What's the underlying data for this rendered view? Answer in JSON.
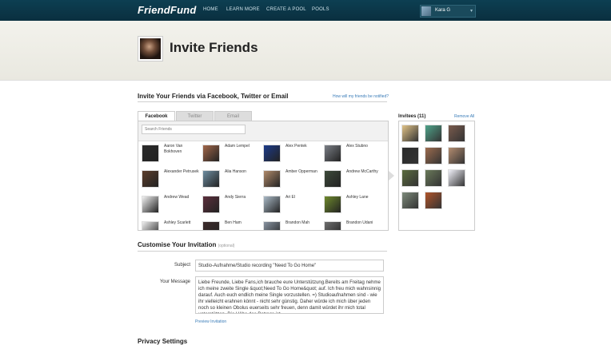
{
  "brand": "FriendFund",
  "nav": [
    "HOME",
    "LEARN MORE",
    "CREATE A POOL",
    "POOLS"
  ],
  "user": {
    "name": "Kara G",
    "avatar_icon": "user-avatar"
  },
  "page_title": "Invite Friends",
  "invite_section": {
    "title": "Invite Your Friends via Facebook, Twitter or Email",
    "help_link": "How will my friends be notified?",
    "tabs": [
      "Facebook",
      "Twitter",
      "Email"
    ],
    "active_tab": "Facebook",
    "search_placeholder": "Search Friends"
  },
  "friends": [
    {
      "name": "Aaron Van Bokhoven",
      "color": "#2a2a2a"
    },
    {
      "name": "Adam Lempel",
      "color": "#a2674a"
    },
    {
      "name": "Alex Pentek",
      "color": "#1d3b8a"
    },
    {
      "name": "Alex Stubno",
      "color": "#7b7f86"
    },
    {
      "name": "Alexander Petrusek",
      "color": "#5b3d2c"
    },
    {
      "name": "Alia Hanson",
      "color": "#6e8da0"
    },
    {
      "name": "Amber Opperman",
      "color": "#b08a6a"
    },
    {
      "name": "Andrew McCarthy",
      "color": "#3d4a3a"
    },
    {
      "name": "Andrew Wead",
      "color": "#f2f2f2"
    },
    {
      "name": "Andy Sierra",
      "color": "#5c2f3c"
    },
    {
      "name": "Ari El",
      "color": "#a9b9c6"
    },
    {
      "name": "Ashley Lane",
      "color": "#6f8a2d"
    },
    {
      "name": "Ashley Scarlett",
      "color": "#eeeeee"
    },
    {
      "name": "Ben Ham",
      "color": "#3d2b2b"
    },
    {
      "name": "Brandon Mah",
      "color": "#8893a0"
    },
    {
      "name": "Brandon Udani",
      "color": "#6e6e6e"
    }
  ],
  "invitees": {
    "title": "Invitees (11)",
    "remove_all": "Remove All",
    "colors": [
      "#e0c287",
      "#4fa38a",
      "#7a5b4d",
      "#2a2a2a",
      "#9c6b4e",
      "#b38c6f",
      "#5a6b3e",
      "#6a7a5a",
      "#f0f0f8",
      "#7d8a7a",
      "#b0542a"
    ]
  },
  "customise": {
    "title": "Customise Your Invitation",
    "optional": "(optional)",
    "subject_label": "Subject",
    "subject_value": "Studio-Aufnahme/Studio recording \"Need To Go Home\"",
    "message_label": "Your Message",
    "message_value": "Liebe Freunde, Liebe Fans,ich brauche eure Unterstützung.Bereits am Freitag nehme ich meine zweite Single &quot;Need To Go Home&quot; auf. Ich freu mich wahnsinnig darauf. Auch euch endlich meine Single vorzustellen. =) Studioaufnahmen sind - wie ihr vielleicht erahnen könnt - nicht sehr günstig. Daher würde ich mich über jeden noch so kleinen Obolus euerseits sehr freuen, denn damit würdet ihr mich total unterstützen. Die Höhe des Betrags ist",
    "preview_link": "Preview Invitation"
  },
  "privacy": {
    "title": "Privacy Settings"
  }
}
